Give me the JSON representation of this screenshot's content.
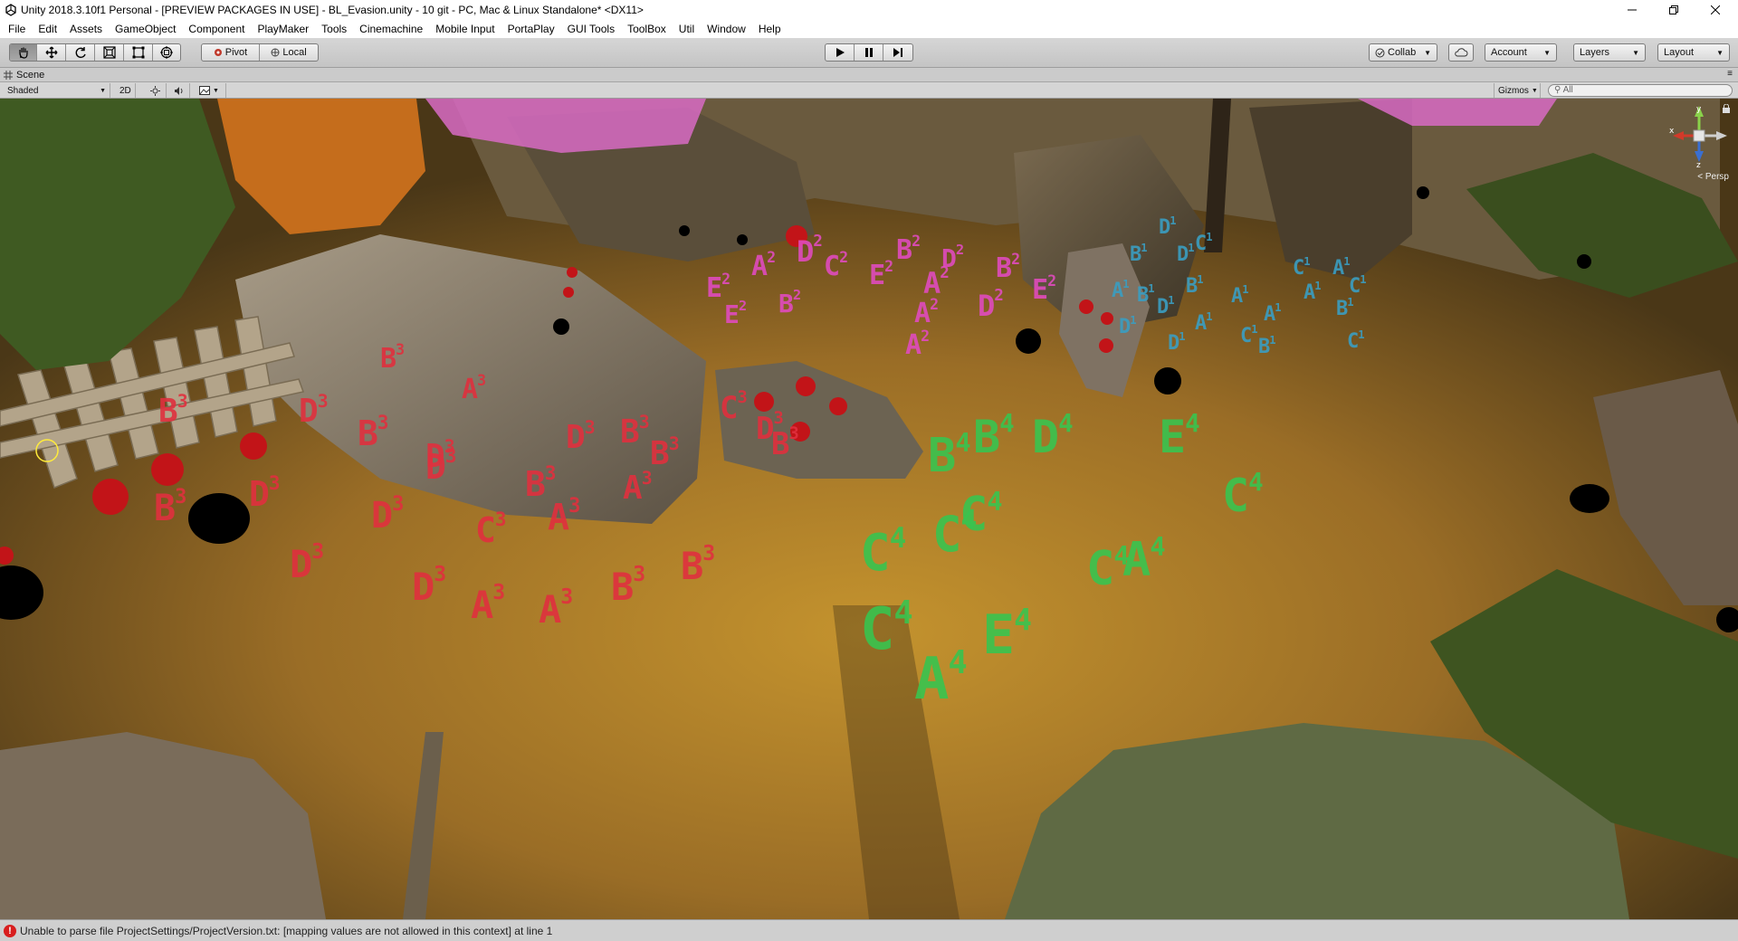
{
  "window": {
    "title": "Unity 2018.3.10f1 Personal - [PREVIEW PACKAGES IN USE] - BL_Evasion.unity - 10 git - PC, Mac & Linux Standalone* <DX11>"
  },
  "menu": [
    "File",
    "Edit",
    "Assets",
    "GameObject",
    "Component",
    "PlayMaker",
    "Tools",
    "Cinemachine",
    "Mobile Input",
    "PortaPlay",
    "GUI Tools",
    "ToolBox",
    "Util",
    "Window",
    "Help"
  ],
  "toolbar": {
    "pivot_label": "Pivot",
    "local_label": "Local",
    "collab_label": "Collab",
    "account_label": "Account",
    "layers_label": "Layers",
    "layout_label": "Layout"
  },
  "scene": {
    "tab_label": "Scene",
    "shading_mode": "Shaded",
    "mode_2d": "2D",
    "gizmos_label": "Gizmos",
    "search_placeholder": "All",
    "persp_label": "Persp",
    "axes": {
      "x": "x",
      "y": "y",
      "z": "z"
    }
  },
  "labels": {
    "pink": [
      {
        "l": "D",
        "s": "2"
      },
      {
        "l": "A",
        "s": "2"
      },
      {
        "l": "C",
        "s": "2"
      },
      {
        "l": "E",
        "s": "2"
      },
      {
        "l": "B",
        "s": "2"
      },
      {
        "l": "E",
        "s": "2"
      },
      {
        "l": "A",
        "s": "2"
      },
      {
        "l": "D",
        "s": "2"
      },
      {
        "l": "E",
        "s": "2"
      },
      {
        "l": "B",
        "s": "2"
      },
      {
        "l": "A",
        "s": "2"
      },
      {
        "l": "D",
        "s": "2"
      },
      {
        "l": "B",
        "s": "2"
      },
      {
        "l": "E",
        "s": "2"
      },
      {
        "l": "A",
        "s": "2"
      }
    ],
    "blue": [
      {
        "l": "D",
        "s": "1"
      },
      {
        "l": "C",
        "s": "1"
      },
      {
        "l": "B",
        "s": "1"
      },
      {
        "l": "D",
        "s": "1"
      },
      {
        "l": "C",
        "s": "1"
      },
      {
        "l": "A",
        "s": "1"
      },
      {
        "l": "A",
        "s": "1"
      },
      {
        "l": "B",
        "s": "1"
      },
      {
        "l": "C",
        "s": "1"
      },
      {
        "l": "A",
        "s": "1"
      },
      {
        "l": "A",
        "s": "1"
      },
      {
        "l": "B",
        "s": "1"
      },
      {
        "l": "D",
        "s": "1"
      },
      {
        "l": "A",
        "s": "1"
      },
      {
        "l": "B",
        "s": "1"
      },
      {
        "l": "A",
        "s": "1"
      },
      {
        "l": "D",
        "s": "1"
      },
      {
        "l": "C",
        "s": "1"
      },
      {
        "l": "B",
        "s": "1"
      },
      {
        "l": "D",
        "s": "1"
      },
      {
        "l": "C",
        "s": "1"
      }
    ],
    "red": [
      {
        "l": "B",
        "s": "3"
      },
      {
        "l": "A",
        "s": "3"
      },
      {
        "l": "D",
        "s": "3"
      },
      {
        "l": "B",
        "s": "3"
      },
      {
        "l": "D",
        "s": "3"
      },
      {
        "l": "D",
        "s": "3"
      },
      {
        "l": "B",
        "s": "3"
      },
      {
        "l": "D",
        "s": "3"
      },
      {
        "l": "B",
        "s": "3"
      },
      {
        "l": "C",
        "s": "3"
      },
      {
        "l": "B",
        "s": "3"
      },
      {
        "l": "D",
        "s": "3"
      },
      {
        "l": "B",
        "s": "3"
      },
      {
        "l": "A",
        "s": "3"
      },
      {
        "l": "B",
        "s": "3"
      },
      {
        "l": "D",
        "s": "3"
      },
      {
        "l": "D",
        "s": "3"
      },
      {
        "l": "C",
        "s": "3"
      },
      {
        "l": "A",
        "s": "3"
      },
      {
        "l": "D",
        "s": "3"
      },
      {
        "l": "D",
        "s": "3"
      },
      {
        "l": "A",
        "s": "3"
      },
      {
        "l": "A",
        "s": "3"
      },
      {
        "l": "B",
        "s": "3"
      },
      {
        "l": "B",
        "s": "3"
      },
      {
        "l": "B",
        "s": "3"
      }
    ],
    "green": [
      {
        "l": "B",
        "s": "4"
      },
      {
        "l": "D",
        "s": "4"
      },
      {
        "l": "B",
        "s": "4"
      },
      {
        "l": "E",
        "s": "4"
      },
      {
        "l": "C",
        "s": "4"
      },
      {
        "l": "C",
        "s": "4"
      },
      {
        "l": "C",
        "s": "4"
      },
      {
        "l": "C",
        "s": "4"
      },
      {
        "l": "A",
        "s": "4"
      },
      {
        "l": "C",
        "s": "4"
      },
      {
        "l": "C",
        "s": "4"
      },
      {
        "l": "E",
        "s": "4"
      },
      {
        "l": "A",
        "s": "4"
      }
    ]
  },
  "status": {
    "message": "Unable to parse file ProjectSettings/ProjectVersion.txt: [mapping values are not allowed in this context] at line 1"
  }
}
